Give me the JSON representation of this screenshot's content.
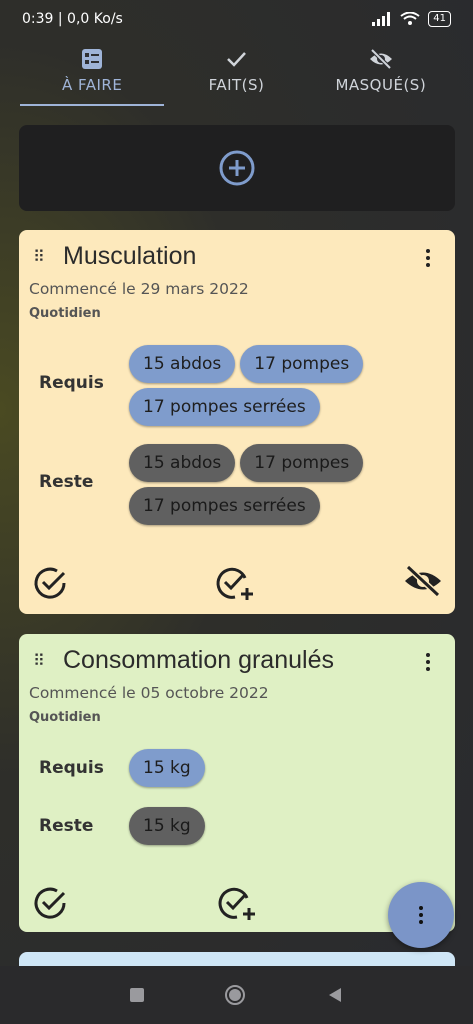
{
  "status_bar": {
    "time_speed": "0:39 | 0,0 Ko/s",
    "battery": "41"
  },
  "tabs": [
    {
      "label": "À FAIRE",
      "icon": "checklist-icon",
      "active": true
    },
    {
      "label": "FAIT(S)",
      "icon": "check-icon",
      "active": false
    },
    {
      "label": "MASQUÉ(S)",
      "icon": "eye-off-icon",
      "active": false
    }
  ],
  "add_bar": {
    "icon": "plus-circle-icon"
  },
  "cards": [
    {
      "title": "Musculation",
      "started": "Commencé le 29 mars 2022",
      "frequency": "Quotidien",
      "required_label": "Requis",
      "remaining_label": "Reste",
      "required": [
        "15 abdos",
        "17 pompes",
        "17 pompes serrées"
      ],
      "remaining": [
        "15 abdos",
        "17 pompes",
        "17 pompes serrées"
      ],
      "color": "#fde9bc"
    },
    {
      "title": "Consommation granulés",
      "started": "Commencé le 05 octobre 2022",
      "frequency": "Quotidien",
      "required_label": "Requis",
      "remaining_label": "Reste",
      "required": [
        "15 kg"
      ],
      "remaining": [
        "15 kg"
      ],
      "color": "#dff0c4"
    }
  ],
  "colors": {
    "accent": "#9fb4d8",
    "chip_required": "#7f9ccc",
    "chip_remaining": "#606060",
    "fab": "#7b95c8"
  }
}
